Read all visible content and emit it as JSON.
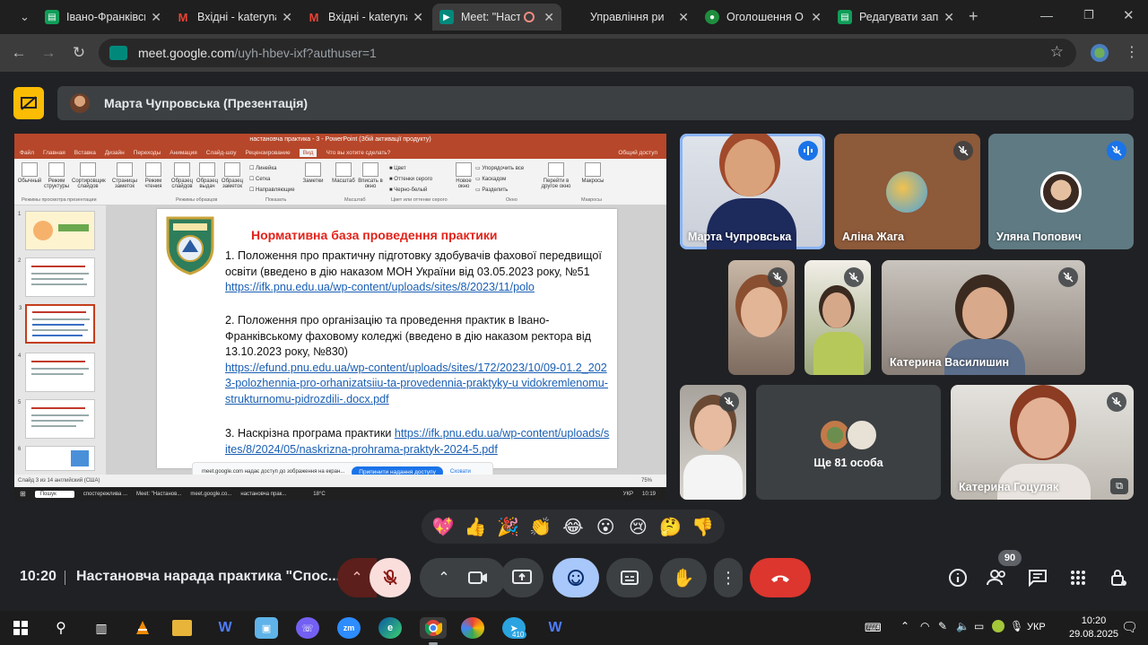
{
  "browser": {
    "tabs": [
      {
        "title": "Івано-Франківськ",
        "icon": "doc-icon",
        "color": "#0f9d58"
      },
      {
        "title": "Вхідні - kateryna",
        "icon": "gmail-icon",
        "color": "#ea4335"
      },
      {
        "title": "Вхідні - kateryna",
        "icon": "gmail-icon",
        "color": "#ea4335"
      },
      {
        "title": "Meet: \"Наста",
        "icon": "meet-icon",
        "color": "#00897b"
      },
      {
        "title": "Управління ри",
        "icon": "blank-icon",
        "color": "#5f6368"
      },
      {
        "title": "Оголошення О",
        "icon": "classroom-icon",
        "color": "#1e8e3e"
      },
      {
        "title": "Редагувати зап",
        "icon": "doc-icon",
        "color": "#0f9d58"
      }
    ],
    "url_host": "meet.google.com",
    "url_path": "/uyh-hbev-ixf?authuser=1"
  },
  "meet": {
    "presenter_label": "Марта Чупровська (Презентація)",
    "time": "10:20",
    "meeting_name": "Настановча нарада практика \"Спос...",
    "participant_count": "90",
    "more_label": "Ще 81 особа",
    "participants": [
      {
        "name": "Марта Чупровська",
        "speaking": true
      },
      {
        "name": "Аліна Жага",
        "muted": true
      },
      {
        "name": "Уляна Попович",
        "muted": true
      },
      {
        "name": "",
        "muted": true
      },
      {
        "name": "",
        "muted": true
      },
      {
        "name": "Катерина Василишин",
        "muted": true
      },
      {
        "name": "",
        "muted": true
      },
      {
        "name": "Катерина Гоцуляк",
        "muted": true
      }
    ],
    "reactions": [
      "💖",
      "👍",
      "🎉",
      "👏",
      "😂",
      "😮",
      "😢",
      "🤔",
      "👎"
    ]
  },
  "screen": {
    "pp_title": "настановча практика - 3  -  PowerPoint (Збій активації продукту)",
    "pp_tabs": [
      "Файл",
      "Главная",
      "Вставка",
      "Дизайн",
      "Переходы",
      "Анимация",
      "Слайд-шоу",
      "Рецензирование",
      "Вид",
      "Что вы хотите сделать?",
      "Общий доступ"
    ],
    "ribbon": [
      "Обычный",
      "Режим структуры",
      "Сортировщик слайдов",
      "Страницы заметок",
      "Режим чтения",
      "Образец слайдов",
      "Образец выдач",
      "Образец заметок",
      "Линейка",
      "Сетка",
      "Направляющие",
      "Заметки",
      "Масштаб",
      "Вписать в окно",
      "Цвет",
      "Оттенки серого",
      "Черно-белый",
      "Новое окно",
      "Упорядочить все",
      "Каскадом",
      "Разделить",
      "Перейти в другое окно",
      "Макросы"
    ],
    "ribbon_sections": [
      "Режимы просмотра презентации",
      "Режимы образцов",
      "Показать",
      "Масштаб",
      "Цвет или оттенки серого",
      "Окно",
      "Макросы"
    ],
    "slide_title": "Нормативна база проведення практики",
    "item1_text": "1. Положення про практичну підготовку здобувачів фахової передвищої освіти (введено в дію наказом МОН України від 03.05.2023 року, №51",
    "item1_link": "https://ifk.pnu.edu.ua/wp-content/uploads/sites/8/2023/11/polo",
    "item2_text": "2. Положення про організацію та проведення практик в Івано-Франківському фаховому коледжі (введено в дію наказом ректора від 13.10.2023 року, №830)",
    "item2_link": "https://efund.pnu.edu.ua/wp-content/uploads/sites/172/2023/10/09-01.2_2023-polozhennia-pro-orhanizatsiiu-ta-provedennia-praktyky-u vidokremlenomu-strukturnomu-pidrozdili-.docx.pdf",
    "item3_text": "3. Наскрізна програма практики ",
    "item3_link": "https://ifk.pnu.edu.ua/wp-content/uploads/sites/8/2024/05/naskrizna-prohrama-praktyk-2024-5.pdf",
    "status": "Слайд 3 из 14     английский (США)",
    "zoom": "75%",
    "notice_text": "meet.google.com надає доступ до зображення на екран...",
    "notice_btn": "Припинити надання доступу",
    "notice_hide": "Сховати",
    "mini_taskbar": [
      "Пошук",
      "спостережлива ...",
      "Meet: \"Настанов...",
      "meet.google.co...",
      "настановча прак...",
      "18°C",
      "УКР",
      "10:19"
    ]
  },
  "taskbar": {
    "time": "10:20",
    "date": "29.08.2025",
    "lang": "УКР",
    "telegram_badge": "410"
  },
  "colors": {
    "meet_bg": "#202124",
    "hangup": "#dc362e",
    "mic_off": "#8c1d18",
    "accent_btn": "#a8c7fa",
    "presenting": "#fbbc04"
  }
}
